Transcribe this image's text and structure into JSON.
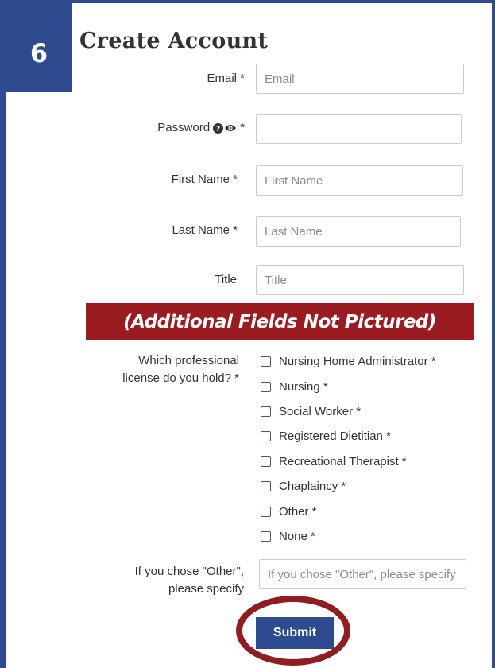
{
  "step_number": "6",
  "title": "Create Account",
  "fields": {
    "email": {
      "label": "Email *",
      "placeholder": "Email"
    },
    "password": {
      "label": "Password",
      "required": "*",
      "placeholder": ""
    },
    "first_name": {
      "label": "First Name *",
      "placeholder": "First Name"
    },
    "last_name": {
      "label": "Last Name *",
      "placeholder": "Last Name"
    },
    "title": {
      "label": "Title",
      "placeholder": "Title"
    }
  },
  "banner": "(Additional Fields Not Pictured)",
  "license": {
    "question_line1": "Which professional",
    "question_line2": "license do you hold? *",
    "options": [
      "Nursing Home Administrator *",
      "Nursing *",
      "Social Worker *",
      "Registered Dietitian *",
      "Recreational Therapist *",
      "Chaplaincy *",
      "Other *",
      "None *"
    ]
  },
  "other": {
    "label_line1": "If you chose \"Other\",",
    "label_line2": "please specify",
    "placeholder": "If you chose \"Other\", please specify"
  },
  "submit_label": "Submit",
  "icons": {
    "help": "question-circle-icon",
    "show_password": "eye-icon"
  },
  "colors": {
    "brand_blue": "#2f4b8f",
    "banner_red": "#9a1c20",
    "highlight_ring": "#8f1d22"
  }
}
